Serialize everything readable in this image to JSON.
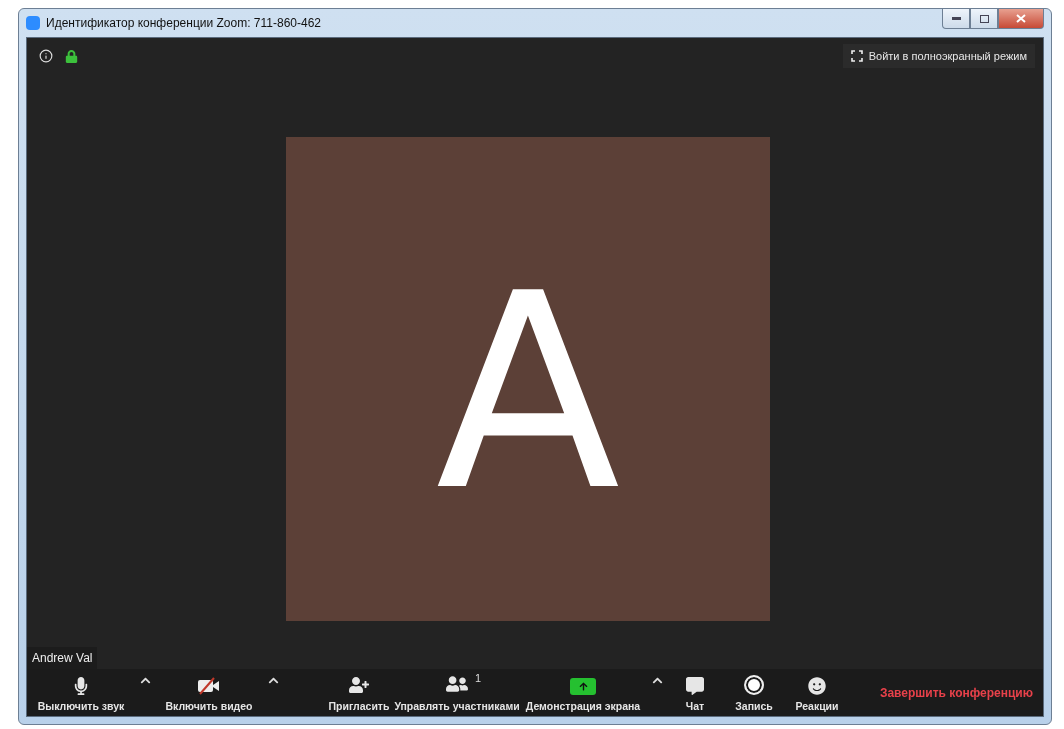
{
  "window": {
    "title": "Идентификатор конференции Zoom: 711-860-462"
  },
  "top_bar": {
    "fullscreen_button": "Войти в полноэкранный режим"
  },
  "video": {
    "avatar_letter": "A",
    "name_tag": "Andrew Val"
  },
  "toolbar": {
    "items": [
      {
        "kind": "mic",
        "label": "Выключить звук",
        "caret": true
      },
      {
        "kind": "video_off",
        "label": "Включить видео",
        "caret": true
      },
      {
        "kind": "invite",
        "label": "Пригласить",
        "caret": false
      },
      {
        "kind": "participants",
        "label": "Управлять участниками",
        "badge": "1",
        "caret": false
      },
      {
        "kind": "share",
        "label": "Демонстрация экрана",
        "caret": true
      },
      {
        "kind": "chat",
        "label": "Чат",
        "caret": false
      },
      {
        "kind": "record",
        "label": "Запись",
        "caret": false
      },
      {
        "kind": "reactions",
        "label": "Реакции",
        "caret": false
      }
    ],
    "end_button": "Завершить конференцию"
  }
}
